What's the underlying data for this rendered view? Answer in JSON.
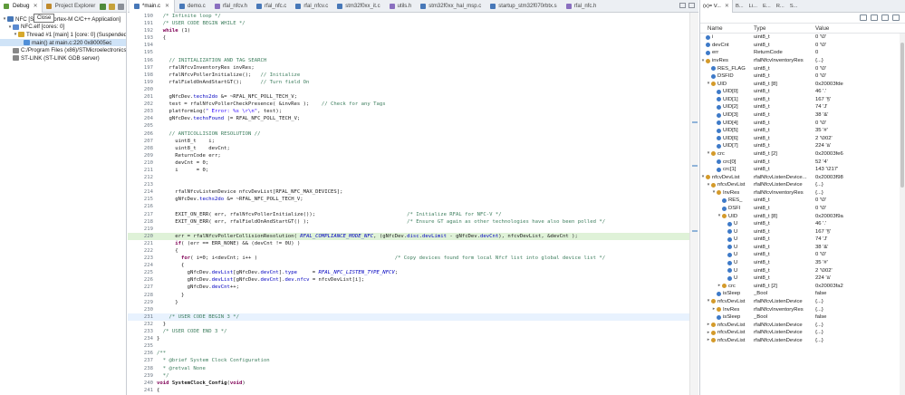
{
  "left": {
    "tabs": [
      {
        "label": "Debug",
        "close": "✕"
      },
      {
        "label": "Project Explorer"
      }
    ],
    "tooltip": "Close",
    "tree": [
      {
        "depth": 0,
        "twisty": "▾",
        "icon": "#4778b8",
        "label": "NFC [STM32 Cortex-M C/C++ Application]"
      },
      {
        "depth": 1,
        "twisty": "▾",
        "icon": "#5b8ad0",
        "label": "NFC.elf [cores: 0]"
      },
      {
        "depth": 2,
        "twisty": "▾",
        "icon": "#d6a82c",
        "label": "Thread #1 [main] 1 [core: 0] (Suspended)"
      },
      {
        "depth": 3,
        "twisty": "",
        "icon": "#4f8fd8",
        "label": "main() at main.c:220 0x80005ec",
        "selected": true
      },
      {
        "depth": 1,
        "twisty": "",
        "icon": "#888888",
        "label": "C:/Program Files (x86)/STMicroelectronics"
      },
      {
        "depth": 1,
        "twisty": "",
        "icon": "#888888",
        "label": "ST-LINK (ST-LINK GDB server)"
      }
    ]
  },
  "editor": {
    "tabs": [
      {
        "label": "*main.c",
        "close": "✕",
        "kind": "c"
      },
      {
        "label": "demo.c",
        "kind": "c"
      },
      {
        "label": "rfal_nfcv.h",
        "kind": "h"
      },
      {
        "label": "rfal_nfc.c",
        "kind": "c"
      },
      {
        "label": "rfal_nfcv.c",
        "kind": "c"
      },
      {
        "label": "stm32f0xx_it.c",
        "kind": "c"
      },
      {
        "label": "utils.h",
        "kind": "h"
      },
      {
        "label": "stm32f0xx_hal_msp.c",
        "kind": "c"
      },
      {
        "label": "startup_stm32f070rbtx.s",
        "kind": "s"
      },
      {
        "label": "rfal_nfc.h",
        "kind": "h"
      }
    ],
    "lines": [
      {
        "n": "190",
        "t": "  <span class='cm'>/* Infinite loop */</span>"
      },
      {
        "n": "191",
        "t": "  <span class='cm'>/* USER CODE BEGIN WHILE */</span>"
      },
      {
        "n": "192",
        "t": "  <span class='kw'>while</span> (1)"
      },
      {
        "n": "193",
        "t": "  {"
      },
      {
        "n": "194",
        "t": ""
      },
      {
        "n": "195",
        "t": ""
      },
      {
        "n": "196",
        "t": "    <span class='cm'>// INITIALIZATION AND TAG SEARCH</span>"
      },
      {
        "n": "197",
        "t": "    rfalNfcvInventoryRes invRes;"
      },
      {
        "n": "198",
        "t": "    rfalNfcvPollerInitialize();   <span class='cm'>// Initialize</span>"
      },
      {
        "n": "199",
        "t": "    rfalFieldOnAndStartGT();      <span class='cm'>// Turn field On</span>"
      },
      {
        "n": "200",
        "t": ""
      },
      {
        "n": "201",
        "t": "    gNfcDev.<span class='fd'>techs2do</span> &amp;= ~RFAL_NFC_POLL_TECH_V;"
      },
      {
        "n": "202",
        "t": "    test = rfalNfcvPollerCheckPresence( &amp;invRes );    <span class='cm'>// Check for any Tags</span>"
      },
      {
        "n": "203",
        "t": "    platformLog(<span class='st'>\" Error: %s \\r\\n\"</span>, test);"
      },
      {
        "n": "204",
        "t": "    gNfcDev.<span class='fd'>techsFound</span> |= RFAL_NFC_POLL_TECH_V;"
      },
      {
        "n": "205",
        "t": ""
      },
      {
        "n": "206",
        "t": "    <span class='cm'>// ANTICOLLISION RESOLUTION //</span>"
      },
      {
        "n": "207",
        "t": "      uint8_t    i;"
      },
      {
        "n": "208",
        "t": "      uint8_t    devCnt;"
      },
      {
        "n": "209",
        "t": "      ReturnCode err;"
      },
      {
        "n": "210",
        "t": "      devCnt = 0;"
      },
      {
        "n": "211",
        "t": "      i      = 0;"
      },
      {
        "n": "212",
        "t": ""
      },
      {
        "n": "213",
        "t": ""
      },
      {
        "n": "214",
        "t": "      rfalNfcvListenDevice nfcvDevList[RFAL_NFC_MAX_DEVICES];"
      },
      {
        "n": "215",
        "t": "      gNfcDev.<span class='fd'>techs2do</span> &amp;= ~RFAL_NFC_POLL_TECH_V;"
      },
      {
        "n": "216",
        "t": ""
      },
      {
        "n": "217",
        "t": "      EXIT_ON_ERR( err, rfalNfcvPollerInitialize());                              <span class='cm'>/* Initialize RFAL for NFC-V */</span>"
      },
      {
        "n": "218",
        "t": "      EXIT_ON_ERR( err, rfalFieldOnAndStartGT() );                                <span class='cm'>/* Ensure GT again as other technologies have also been polled */</span>"
      },
      {
        "n": "219",
        "t": ""
      },
      {
        "n": "220",
        "t": "      err = rfalNfcvPollerCollisionResolution( <span class='it'>RFAL_COMPLIANCE_MODE_NFC</span>, (gNfcDev.<span class='fd'>disc</span>.<span class='fd'>devLimit</span> - gNfcDev.<span class='fd'>devCnt</span>), nfcvDevList, &amp;devCnt );",
        "hl": true
      },
      {
        "n": "221",
        "t": "      <span class='kw'>if</span>( (err == ERR_NONE) &amp;&amp; (devCnt != 0U) )"
      },
      {
        "n": "222",
        "t": "      {"
      },
      {
        "n": "223",
        "t": "        <span class='kw'>for</span>( i=0; i&lt;devCnt; i++ )                                             <span class='cm'>/* Copy devices found form local Nfcf list into global device list */</span>"
      },
      {
        "n": "224",
        "t": "        {"
      },
      {
        "n": "225",
        "t": "          gNfcDev.<span class='fd'>devList</span>[gNfcDev.<span class='fd'>devCnt</span>].<span class='fd'>type</span>     = <span class='it'>RFAL_NFC_LISTEN_TYPE_NFCV</span>;"
      },
      {
        "n": "226",
        "t": "          gNfcDev.<span class='fd'>devList</span>[gNfcDev.<span class='fd'>devCnt</span>].<span class='fd'>dev</span>.<span class='fd'>nfcv</span> = nfcvDevList[i];"
      },
      {
        "n": "227",
        "t": "          gNfcDev.<span class='fd'>devCnt</span>++;"
      },
      {
        "n": "228",
        "t": "        }"
      },
      {
        "n": "229",
        "t": "      }"
      },
      {
        "n": "230",
        "t": ""
      },
      {
        "n": "231",
        "t": "    <span class='cm'>/* USER CODE BEGIN 3 */</span>",
        "cur": true
      },
      {
        "n": "232",
        "t": "  }"
      },
      {
        "n": "233",
        "t": "  <span class='cm'>/* USER CODE END 3 */</span>"
      },
      {
        "n": "234",
        "t": "}"
      },
      {
        "n": "235",
        "t": ""
      },
      {
        "n": "236",
        "t": "<span class='cm'>/**</span>"
      },
      {
        "n": "237",
        "t": "<span class='cm'>  * @brief System Clock Configuration</span>"
      },
      {
        "n": "238",
        "t": "<span class='cm'>  * @retval None</span>"
      },
      {
        "n": "239",
        "t": "<span class='cm'>  */</span>"
      },
      {
        "n": "240",
        "t": "<span class='kw'>void</span> <b>SystemClock_Config</b>(<span class='kw'>void</span>)"
      },
      {
        "n": "241",
        "t": "{"
      }
    ]
  },
  "vars": {
    "tabs": [
      {
        "label": "(x)= V...",
        "close": "✕"
      },
      {
        "label": "B..."
      },
      {
        "label": "Li..."
      },
      {
        "label": "E..."
      },
      {
        "label": "R..."
      },
      {
        "label": "S..."
      }
    ],
    "headers": {
      "name": "Name",
      "type": "Type",
      "value": "Value"
    },
    "rows": [
      {
        "d": 0,
        "tw": "",
        "ic": "f",
        "name": "i",
        "type": "uint8_t",
        "value": "0 '\\0'"
      },
      {
        "d": 0,
        "tw": "",
        "ic": "f",
        "name": "devCnt",
        "type": "uint8_t",
        "value": "0 '\\0'"
      },
      {
        "d": 0,
        "tw": "",
        "ic": "f",
        "name": "err",
        "type": "ReturnCode",
        "value": "0"
      },
      {
        "d": 0,
        "tw": "▾",
        "ic": "s",
        "name": "invRes",
        "type": "rfalNfcvInventoryRes",
        "value": "{...}"
      },
      {
        "d": 1,
        "tw": "",
        "ic": "f",
        "name": "RES_FLAG",
        "type": "uint8_t",
        "value": "0 '\\0'"
      },
      {
        "d": 1,
        "tw": "",
        "ic": "f",
        "name": "DSFID",
        "type": "uint8_t",
        "value": "0 '\\0'"
      },
      {
        "d": 1,
        "tw": "▾",
        "ic": "s",
        "name": "UID",
        "type": "uint8_t [8]",
        "value": "0x20003fde"
      },
      {
        "d": 2,
        "tw": "",
        "ic": "f",
        "name": "UID[0]",
        "type": "uint8_t",
        "value": "46 '.'"
      },
      {
        "d": 2,
        "tw": "",
        "ic": "f",
        "name": "UID[1]",
        "type": "uint8_t",
        "value": "167 '§'"
      },
      {
        "d": 2,
        "tw": "",
        "ic": "f",
        "name": "UID[2]",
        "type": "uint8_t",
        "value": "74 'J'"
      },
      {
        "d": 2,
        "tw": "",
        "ic": "f",
        "name": "UID[3]",
        "type": "uint8_t",
        "value": "38 '&'"
      },
      {
        "d": 2,
        "tw": "",
        "ic": "f",
        "name": "UID[4]",
        "type": "uint8_t",
        "value": "0 '\\0'"
      },
      {
        "d": 2,
        "tw": "",
        "ic": "f",
        "name": "UID[5]",
        "type": "uint8_t",
        "value": "35 '#'"
      },
      {
        "d": 2,
        "tw": "",
        "ic": "f",
        "name": "UID[6]",
        "type": "uint8_t",
        "value": "2 '\\002'"
      },
      {
        "d": 2,
        "tw": "",
        "ic": "f",
        "name": "UID[7]",
        "type": "uint8_t",
        "value": "224 'à'"
      },
      {
        "d": 1,
        "tw": "▾",
        "ic": "s",
        "name": "crc",
        "type": "uint8_t [2]",
        "value": "0x20003fe6"
      },
      {
        "d": 2,
        "tw": "",
        "ic": "f",
        "name": "crc[0]",
        "type": "uint8_t",
        "value": "52 '4'"
      },
      {
        "d": 2,
        "tw": "",
        "ic": "f",
        "name": "crc[1]",
        "type": "uint8_t",
        "value": "143 '\\217'"
      },
      {
        "d": 0,
        "tw": "▾",
        "ic": "s",
        "name": "nfcvDevList",
        "type": "rfalNfcvListenDevice...",
        "value": "0x20003f98"
      },
      {
        "d": 1,
        "tw": "▾",
        "ic": "s",
        "name": "nfcvDevList",
        "type": "rfalNfcvListenDevice",
        "value": "{...}"
      },
      {
        "d": 2,
        "tw": "▾",
        "ic": "s",
        "name": "InvRes",
        "type": "rfalNfcvInventoryRes",
        "value": "{...}"
      },
      {
        "d": 3,
        "tw": "",
        "ic": "f",
        "name": "RES_",
        "type": "uint8_t",
        "value": "0 '\\0'"
      },
      {
        "d": 3,
        "tw": "",
        "ic": "f",
        "name": "DSFI",
        "type": "uint8_t",
        "value": "0 '\\0'"
      },
      {
        "d": 3,
        "tw": "▾",
        "ic": "s",
        "name": "UID",
        "type": "uint8_t [8]",
        "value": "0x20003f9a"
      },
      {
        "d": 4,
        "tw": "",
        "ic": "f",
        "name": "U",
        "type": "uint8_t",
        "value": "46 '.'"
      },
      {
        "d": 4,
        "tw": "",
        "ic": "f",
        "name": "U",
        "type": "uint8_t",
        "value": "167 '§'"
      },
      {
        "d": 4,
        "tw": "",
        "ic": "f",
        "name": "U",
        "type": "uint8_t",
        "value": "74 'J'"
      },
      {
        "d": 4,
        "tw": "",
        "ic": "f",
        "name": "U",
        "type": "uint8_t",
        "value": "38 '&'"
      },
      {
        "d": 4,
        "tw": "",
        "ic": "f",
        "name": "U",
        "type": "uint8_t",
        "value": "0 '\\0'"
      },
      {
        "d": 4,
        "tw": "",
        "ic": "f",
        "name": "U",
        "type": "uint8_t",
        "value": "35 '#'"
      },
      {
        "d": 4,
        "tw": "",
        "ic": "f",
        "name": "U",
        "type": "uint8_t",
        "value": "2 '\\002'"
      },
      {
        "d": 4,
        "tw": "",
        "ic": "f",
        "name": "U",
        "type": "uint8_t",
        "value": "224 'à'"
      },
      {
        "d": 3,
        "tw": "▸",
        "ic": "s",
        "name": "crc",
        "type": "uint8_t [2]",
        "value": "0x20003fa2"
      },
      {
        "d": 2,
        "tw": "",
        "ic": "f",
        "name": "isSleep",
        "type": "_Bool",
        "value": "false"
      },
      {
        "d": 1,
        "tw": "▾",
        "ic": "s",
        "name": "nfcvDevList",
        "type": "rfalNfcvListenDevice",
        "value": "{...}"
      },
      {
        "d": 2,
        "tw": "▸",
        "ic": "s",
        "name": "InvRes",
        "type": "rfalNfcvInventoryRes",
        "value": "{...}"
      },
      {
        "d": 2,
        "tw": "",
        "ic": "f",
        "name": "isSleep",
        "type": "_Bool",
        "value": "false"
      },
      {
        "d": 1,
        "tw": "▸",
        "ic": "s",
        "name": "nfcvDevList",
        "type": "rfalNfcvListenDevice",
        "value": "{...}"
      },
      {
        "d": 1,
        "tw": "▸",
        "ic": "s",
        "name": "nfcvDevList",
        "type": "rfalNfcvListenDevice",
        "value": "{...}"
      },
      {
        "d": 1,
        "tw": "▸",
        "ic": "s",
        "name": "nfcvDevList",
        "type": "rfalNfcvListenDevice",
        "value": "{...}"
      }
    ]
  }
}
